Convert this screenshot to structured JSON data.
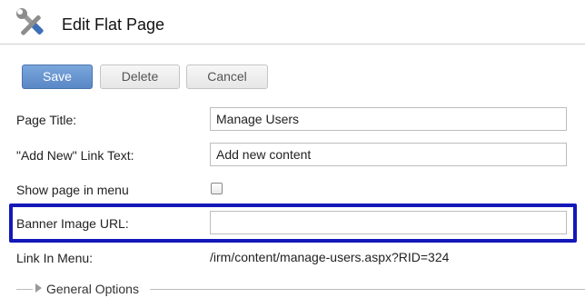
{
  "header": {
    "icon": "tools-icon",
    "title": "Edit Flat Page"
  },
  "toolbar": {
    "save_label": "Save",
    "delete_label": "Delete",
    "cancel_label": "Cancel"
  },
  "form": {
    "page_title": {
      "label": "Page Title:",
      "value": "Manage Users"
    },
    "add_new_link_text": {
      "label": "\"Add New\" Link Text:",
      "value": "Add new content"
    },
    "show_in_menu": {
      "label": "Show page in menu",
      "checked": false
    },
    "banner_image_url": {
      "label": "Banner Image URL:",
      "value": ""
    },
    "link_in_menu": {
      "label": "Link In Menu:",
      "value": "/irm/content/manage-users.aspx?RID=324"
    }
  },
  "sections": {
    "general_options": {
      "label": "General Options",
      "expanded": false
    }
  },
  "colors": {
    "primary_button": "#6b98d3",
    "highlight_border": "#1418b8"
  }
}
